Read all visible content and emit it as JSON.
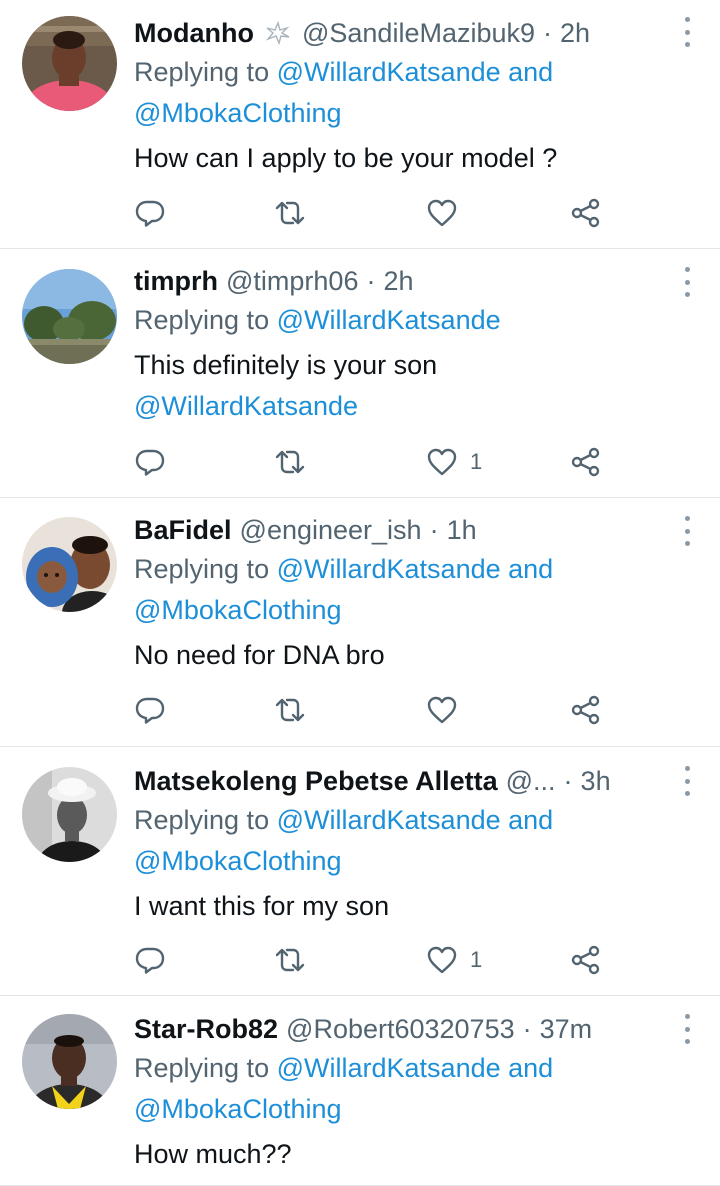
{
  "tweets": [
    {
      "name": "Modanho",
      "handle": "@SandileMazibuk9",
      "separator": "·",
      "time": "2h",
      "replying_prefix": "Replying to",
      "reply_line1": "@WillardKatsande and",
      "reply_line2": "@MbokaClothing",
      "body_line1": "How can I apply to be your model ?",
      "body_line2": "",
      "like_count": "",
      "avatar_colors": {
        "bg": "#6b5a4a",
        "shirt": "#e85a78",
        "skin": "#6a3e2a"
      }
    },
    {
      "name": "timprh",
      "handle": "@timprh06",
      "separator": "·",
      "time": "2h",
      "replying_prefix": "Replying to",
      "reply_line1": "@WillardKatsande",
      "reply_line2": "",
      "body_line1": "This definitely is your son",
      "body_line2": "@WillardKatsande",
      "like_count": "1",
      "avatar_colors": {
        "sky": "#6aa0d8",
        "trees": "#3f5a2e",
        "ground": "#8a8a6a"
      }
    },
    {
      "name": "BaFidel",
      "handle": "@engineer_ish",
      "separator": "·",
      "time": "1h",
      "replying_prefix": "Replying to",
      "reply_line1": "@WillardKatsande and",
      "reply_line2": "@MbokaClothing",
      "body_line1": "No need for DNA bro",
      "body_line2": "",
      "like_count": "",
      "avatar_colors": {
        "bg": "#e8e2da",
        "hat": "#3a6fb8",
        "skin": "#7a4a30"
      }
    },
    {
      "name": "Matsekoleng Pebetse Alletta",
      "handle": "@...",
      "separator": "·",
      "time": "3h",
      "replying_prefix": "Replying to",
      "reply_line1": "@WillardKatsande and",
      "reply_line2": "@MbokaClothing",
      "body_line1": "I want this  for my son",
      "body_line2": "",
      "like_count": "1",
      "avatar_colors": {
        "bg": "#dcdcdc",
        "hat": "#f2f2f2",
        "face": "#5a5a5a"
      }
    },
    {
      "name": "Star-Rob82",
      "handle": "@Robert60320753",
      "separator": "·",
      "time": "37m",
      "replying_prefix": "Replying to",
      "reply_line1": "@WillardKatsande and",
      "reply_line2": "@MbokaClothing",
      "body_line1": "How much??",
      "body_line2": "",
      "like_count": "",
      "avatar_colors": {
        "bg": "#b8bcc4",
        "shirt": "#2a2a2a",
        "collar": "#f2d21a",
        "skin": "#4a2e22"
      }
    }
  ],
  "colors": {
    "link": "#1d8fd8",
    "secondary": "#536471",
    "text": "#0f1419",
    "divider": "#e1e6ea"
  },
  "icons": [
    "reply-icon",
    "retweet-icon",
    "like-icon",
    "share-icon",
    "more-icon",
    "sparkle-badge-icon"
  ]
}
